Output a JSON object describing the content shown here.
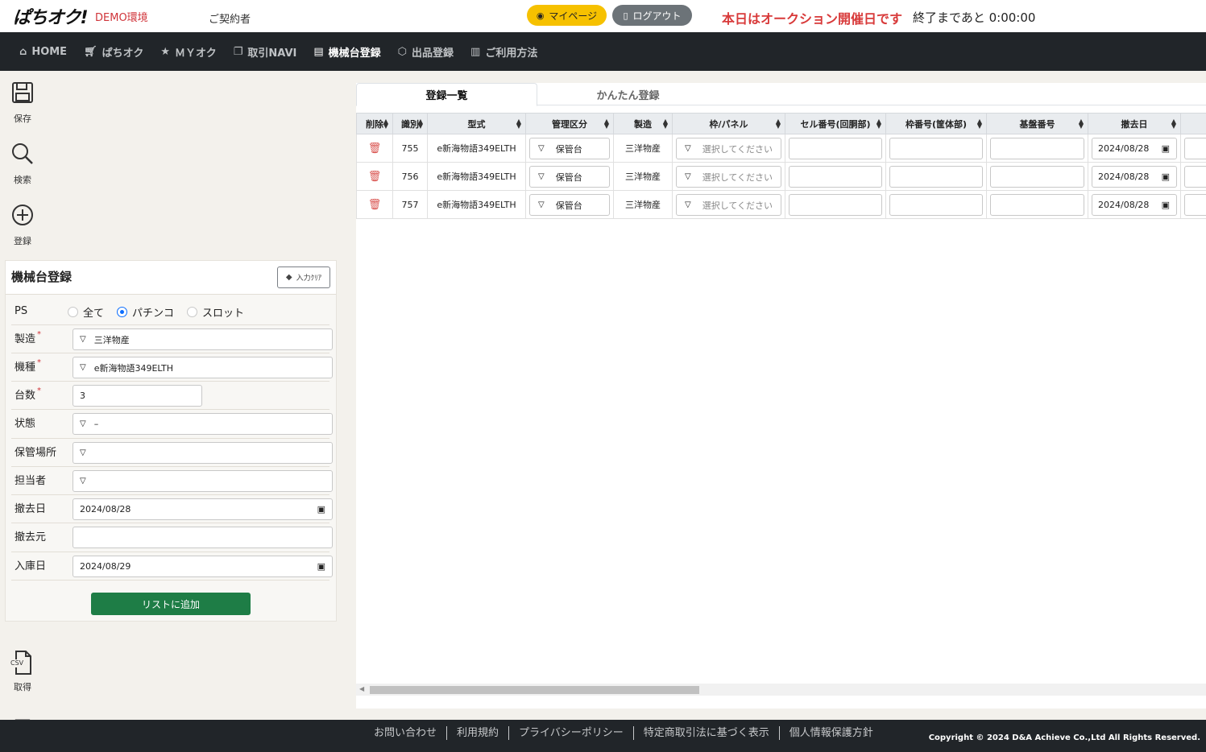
{
  "header": {
    "logo": "ぱちオク!",
    "env_label": "DEMO環境",
    "contractor": "ご契約者",
    "mypage_label": "マイページ",
    "logout_label": "ログアウト",
    "auction_msg": "本日はオークション開催日です",
    "countdown_text": "終了まであと 0:00:00",
    "colors": {
      "mypage": "#f6c100",
      "logout": "#6c7378",
      "alert": "#d83a3a"
    }
  },
  "nav": {
    "items": [
      {
        "label": "HOME",
        "icon": "home-icon"
      },
      {
        "label": "ぱちオク",
        "icon": "cart-icon"
      },
      {
        "label": "ＭＹオク",
        "icon": "star-icon"
      },
      {
        "label": "取引NAVI",
        "icon": "copy-icon"
      },
      {
        "label": "機械台登録",
        "icon": "device-icon",
        "active": true
      },
      {
        "label": "出品登録",
        "icon": "box-icon"
      },
      {
        "label": "ご利用方法",
        "icon": "book-icon"
      }
    ]
  },
  "tools": {
    "save": "保存",
    "search": "検索",
    "register": "登録",
    "csv_icon_text": "CSV",
    "csv": "取得"
  },
  "form": {
    "title": "機械台登録",
    "clear_label": "入力ｸﾘｱ",
    "ps_label": "PS",
    "ps_options": [
      "全て",
      "パチンコ",
      "スロット"
    ],
    "ps_selected": "パチンコ",
    "maker_label": "製造",
    "maker_value": "三洋物産",
    "model_label": "機種",
    "model_value": "e新海物語349ELTH",
    "count_label": "台数",
    "count_value": "3",
    "state_label": "状態",
    "state_value": "–",
    "storage_label": "保管場所",
    "storage_value": "",
    "person_label": "担当者",
    "person_value": "",
    "removal_date_label": "撤去日",
    "removal_date_value": "2024/08/28",
    "removal_src_label": "撤去元",
    "removal_src_value": "",
    "stock_date_label": "入庫日",
    "stock_date_value": "2024/08/29",
    "required_mark": "*",
    "add_button": "リストに追加",
    "accent": "#1e7d46"
  },
  "tabs": [
    "登録一覧",
    "かんたん登録"
  ],
  "grid": {
    "columns": [
      "削除",
      "識別",
      "型式",
      "管理区分",
      "製造",
      "枠/パネル",
      "セル番号(回胴部)",
      "枠番号(筐体部)",
      "基盤番号",
      "撤去日",
      ""
    ],
    "select_placeholder": "選択してください",
    "rows": [
      {
        "id": "755",
        "model": "e新海物語349ELTH",
        "category": "保管台",
        "maker": "三洋物産",
        "removal_date": "2024/08/28"
      },
      {
        "id": "756",
        "model": "e新海物語349ELTH",
        "category": "保管台",
        "maker": "三洋物産",
        "removal_date": "2024/08/28"
      },
      {
        "id": "757",
        "model": "e新海物語349ELTH",
        "category": "保管台",
        "maker": "三洋物産",
        "removal_date": "2024/08/28"
      }
    ]
  },
  "footer": {
    "links": [
      "お問い合わせ",
      "利用規約",
      "プライバシーポリシー",
      "特定商取引法に基づく表示",
      "個人情報保護方針"
    ],
    "copyright": "Copyright © 2024 D&A Achieve Co.,Ltd All Rights Reserved."
  }
}
